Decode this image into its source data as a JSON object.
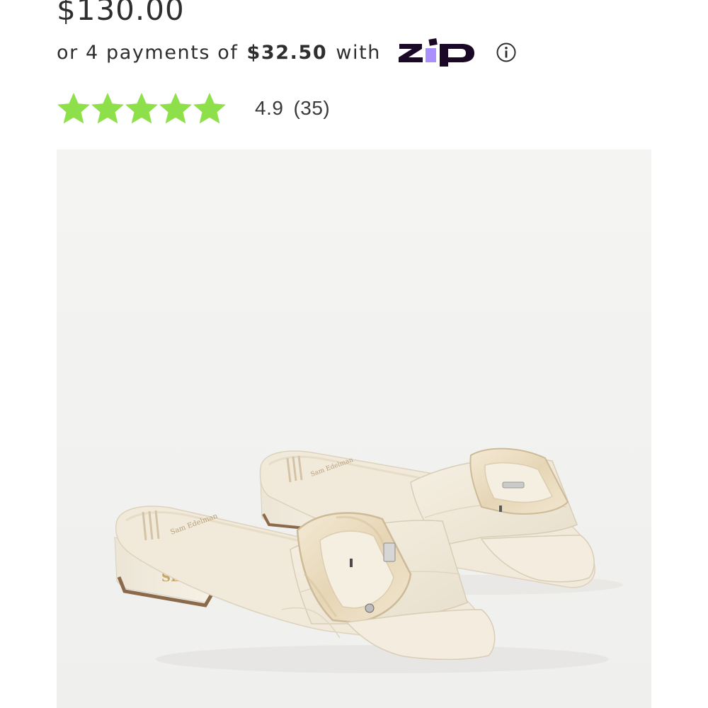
{
  "product": {
    "price": "$130.00",
    "installments": {
      "prefix": "or 4 payments of",
      "amount": "$32.50",
      "suffix": "with",
      "provider_icon": "zip-logo",
      "info_icon": "info-icon"
    },
    "rating": {
      "stars": 5,
      "star_color": "#8ee04a",
      "score": "4.9",
      "count": "(35)"
    },
    "image": {
      "subject": "slide sandals",
      "background": "#f2f2f0"
    }
  }
}
